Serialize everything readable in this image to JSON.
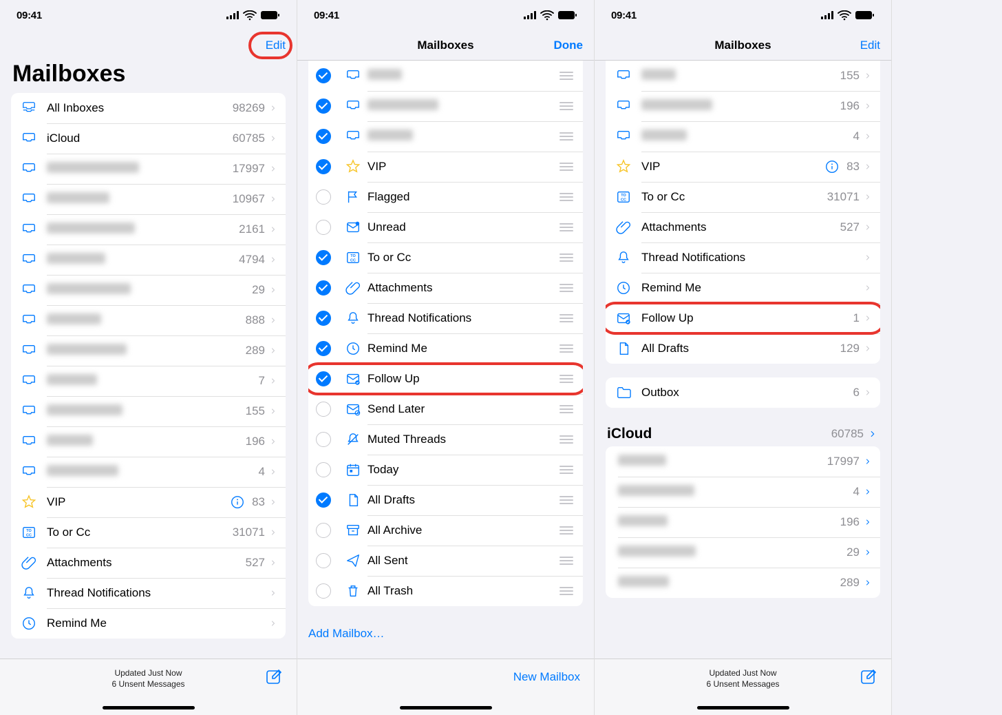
{
  "status": {
    "time": "09:41"
  },
  "screens": [
    {
      "nav": {
        "right": "Edit",
        "title_large": "Mailboxes"
      },
      "toolbar": {
        "line1": "Updated Just Now",
        "line2": "6 Unsent Messages"
      },
      "items": [
        {
          "icon": "tray-all",
          "label": "All Inboxes",
          "count": "98269"
        },
        {
          "icon": "tray",
          "label": "iCloud",
          "count": "60785"
        },
        {
          "icon": "tray",
          "label": "———",
          "count": "17997",
          "blurred": true
        },
        {
          "icon": "tray",
          "label": "———",
          "count": "10967",
          "blurred": true
        },
        {
          "icon": "tray",
          "label": "———",
          "count": "2161",
          "blurred": true
        },
        {
          "icon": "tray",
          "label": "———",
          "count": "4794",
          "blurred": true
        },
        {
          "icon": "tray",
          "label": "———",
          "count": "29",
          "blurred": true
        },
        {
          "icon": "tray",
          "label": "———",
          "count": "888",
          "blurred": true
        },
        {
          "icon": "tray",
          "label": "———",
          "count": "289",
          "blurred": true
        },
        {
          "icon": "tray",
          "label": "———",
          "count": "7",
          "blurred": true
        },
        {
          "icon": "tray",
          "label": "———",
          "count": "155",
          "blurred": true
        },
        {
          "icon": "tray",
          "label": "———",
          "count": "196",
          "blurred": true
        },
        {
          "icon": "tray",
          "label": "———",
          "count": "4",
          "blurred": true
        },
        {
          "icon": "star",
          "label": "VIP",
          "count": "83",
          "info": true
        },
        {
          "icon": "tocc",
          "label": "To or Cc",
          "count": "31071"
        },
        {
          "icon": "paperclip",
          "label": "Attachments",
          "count": "527"
        },
        {
          "icon": "bell",
          "label": "Thread Notifications",
          "count": ""
        },
        {
          "icon": "clock",
          "label": "Remind Me",
          "count": ""
        }
      ]
    },
    {
      "nav": {
        "title": "Mailboxes",
        "right": "Done"
      },
      "add_mailbox": "Add Mailbox…",
      "toolbar": {
        "right": "New Mailbox"
      },
      "items": [
        {
          "checked": true,
          "icon": "tray",
          "blurred": true,
          "label": "———"
        },
        {
          "checked": true,
          "icon": "tray",
          "blurred": true,
          "label": "———"
        },
        {
          "checked": true,
          "icon": "tray",
          "blurred": true,
          "label": "———"
        },
        {
          "checked": true,
          "icon": "star",
          "label": "VIP"
        },
        {
          "checked": false,
          "icon": "flag",
          "label": "Flagged"
        },
        {
          "checked": false,
          "icon": "unread",
          "label": "Unread"
        },
        {
          "checked": true,
          "icon": "tocc",
          "label": "To or Cc"
        },
        {
          "checked": true,
          "icon": "paperclip",
          "label": "Attachments"
        },
        {
          "checked": true,
          "icon": "bell",
          "label": "Thread Notifications"
        },
        {
          "checked": true,
          "icon": "clock",
          "label": "Remind Me"
        },
        {
          "checked": true,
          "icon": "followup",
          "label": "Follow Up",
          "highlight": true
        },
        {
          "checked": false,
          "icon": "sendlater",
          "label": "Send Later"
        },
        {
          "checked": false,
          "icon": "muted",
          "label": "Muted Threads"
        },
        {
          "checked": false,
          "icon": "today",
          "label": "Today"
        },
        {
          "checked": true,
          "icon": "doc",
          "label": "All Drafts"
        },
        {
          "checked": false,
          "icon": "archive",
          "label": "All Archive"
        },
        {
          "checked": false,
          "icon": "sent",
          "label": "All Sent"
        },
        {
          "checked": false,
          "icon": "trash",
          "label": "All Trash"
        }
      ]
    },
    {
      "nav": {
        "title": "Mailboxes",
        "right": "Edit"
      },
      "toolbar": {
        "line1": "Updated Just Now",
        "line2": "6 Unsent Messages"
      },
      "items": [
        {
          "icon": "tray",
          "label": "———",
          "count": "155",
          "blurred": true
        },
        {
          "icon": "tray",
          "label": "———",
          "count": "196",
          "blurred": true
        },
        {
          "icon": "tray",
          "label": "———",
          "count": "4",
          "blurred": true
        },
        {
          "icon": "star",
          "label": "VIP",
          "count": "83",
          "info": true
        },
        {
          "icon": "tocc",
          "label": "To or Cc",
          "count": "31071"
        },
        {
          "icon": "paperclip",
          "label": "Attachments",
          "count": "527"
        },
        {
          "icon": "bell",
          "label": "Thread Notifications",
          "count": ""
        },
        {
          "icon": "clock",
          "label": "Remind Me",
          "count": ""
        },
        {
          "icon": "followup",
          "label": "Follow Up",
          "count": "1",
          "highlight": true
        },
        {
          "icon": "doc",
          "label": "All Drafts",
          "count": "129"
        }
      ],
      "outbox": {
        "icon": "folder",
        "label": "Outbox",
        "count": "6"
      },
      "section": {
        "title": "iCloud",
        "count": "60785"
      },
      "section_items": [
        {
          "label": "———",
          "count": "17997",
          "blurred": true
        },
        {
          "label": "———",
          "count": "4",
          "blurred": true
        },
        {
          "label": "———",
          "count": "196",
          "blurred": true
        },
        {
          "label": "———",
          "count": "29",
          "blurred": true
        },
        {
          "label": "———",
          "count": "289",
          "blurred": true
        }
      ]
    }
  ]
}
